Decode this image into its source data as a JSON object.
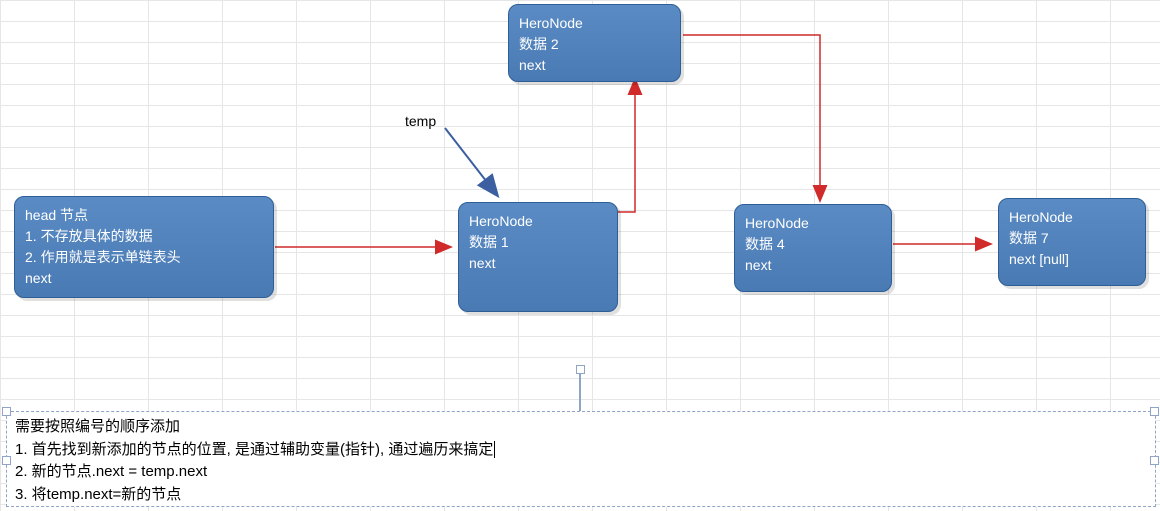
{
  "nodes": {
    "head": {
      "line1": "head 节点",
      "line2": "1. 不存放具体的数据",
      "line3": "2. 作用就是表示单链表头",
      "line4": "next"
    },
    "n1": {
      "line1": "HeroNode",
      "line2": "数据 1",
      "line3": "next"
    },
    "n2": {
      "line1": "HeroNode",
      "line2": "数据 2",
      "line3": "next"
    },
    "n4": {
      "line1": "HeroNode",
      "line2": "数据 4",
      "line3": "next"
    },
    "n7": {
      "line1": "HeroNode",
      "line2": "数据 7",
      "line3": "next [null]"
    }
  },
  "labels": {
    "temp": "temp"
  },
  "notes": {
    "title": "需要按照编号的顺序添加",
    "step1": "1. 首先找到新添加的节点的位置, 是通过辅助变量(指针), 通过遍历来搞定",
    "step2": "2. 新的节点.next = temp.next",
    "step3": "3. 将temp.next=新的节点"
  },
  "colors": {
    "nodeFill": "#4f7fb8",
    "arrowRed": "#d12a2a",
    "arrowBlue": "#3b5fa0",
    "selection": "#8fa4c7",
    "rotHandle": "#7dd24b"
  }
}
